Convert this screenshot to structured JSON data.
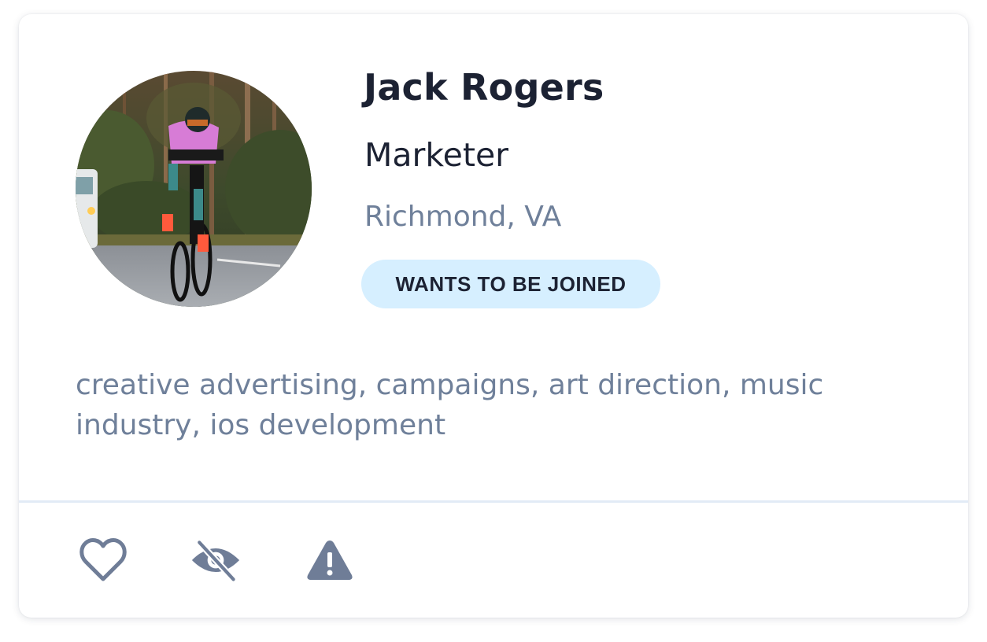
{
  "profile": {
    "name": "Jack Rogers",
    "role": "Marketer",
    "location": "Richmond, VA",
    "badge": "WANTS TO BE JOINED",
    "tags": "creative advertising, campaigns, art direction, music industry, ios development"
  },
  "actions": [
    {
      "icon": "heart-icon"
    },
    {
      "icon": "eye-off-icon"
    },
    {
      "icon": "warning-icon"
    }
  ],
  "colors": {
    "text_primary": "#1c2233",
    "text_secondary": "#6f809a",
    "badge_background": "#d6efff",
    "icon": "#6f7d97",
    "divider": "#e2ebf6"
  }
}
